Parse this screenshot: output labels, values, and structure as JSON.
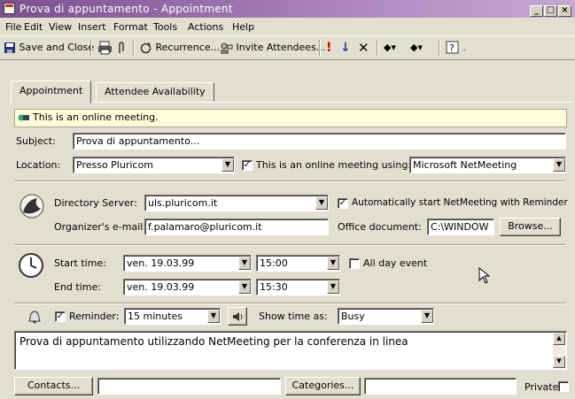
{
  "window": {
    "title": "Prova di appuntamento - Appointment",
    "controls": [
      "_",
      "□",
      "×"
    ]
  },
  "menu": [
    "File",
    "Edit",
    "View",
    "Insert",
    "Format",
    "Tools",
    "Actions",
    "Help"
  ],
  "toolbar": {
    "save_close": "Save and Close",
    "recurrence": "Recurrence...",
    "invite": "Invite Attendees..."
  },
  "tabs": [
    "Appointment",
    "Attendee Availability"
  ],
  "info_bar": "This is an online meeting.",
  "subject": {
    "label": "Subject:",
    "value": "Prova di appuntamento..."
  },
  "location": {
    "label": "Location:",
    "value": "Presso Pluricom",
    "online_label": "This is an online meeting using:",
    "online_checked": true,
    "online_value": "Microsoft NetMeeting"
  },
  "netmeeting": {
    "directory_label": "Directory Server:",
    "directory_value": "uls.pluricom.it",
    "auto_start_label": "Automatically start NetMeeting with Reminder",
    "auto_start_checked": true,
    "organizer_label": "Organizer's e-mail:",
    "organizer_value": "f.palamaro@pluricom.it",
    "office_doc_label": "Office document:",
    "office_doc_value": "C:\\WINDOW",
    "browse_label": "Browse..."
  },
  "time": {
    "start_label": "Start time:",
    "start_date": "ven. 19.03.99",
    "start_time": "15:00",
    "end_label": "End time:",
    "end_date": "ven. 19.03.99",
    "end_time": "15:30",
    "allday_label": "All day event",
    "allday_checked": false
  },
  "reminder": {
    "label": "Reminder:",
    "checked": true,
    "value": "15 minutes",
    "showtime_label": "Show time as:",
    "showtime_value": "Busy"
  },
  "notes": "Prova di appuntamento utilizzando NetMeeting per la conferenza in linea",
  "footer": {
    "contacts_label": "Contacts...",
    "contacts_value": "",
    "categories_label": "Categories...",
    "categories_value": "",
    "private_label": "Private",
    "private_checked": false
  },
  "colors": {
    "titlebar": "#7a4f8e",
    "info_bar": "#fffbd8",
    "window": "#e3dfd0"
  }
}
